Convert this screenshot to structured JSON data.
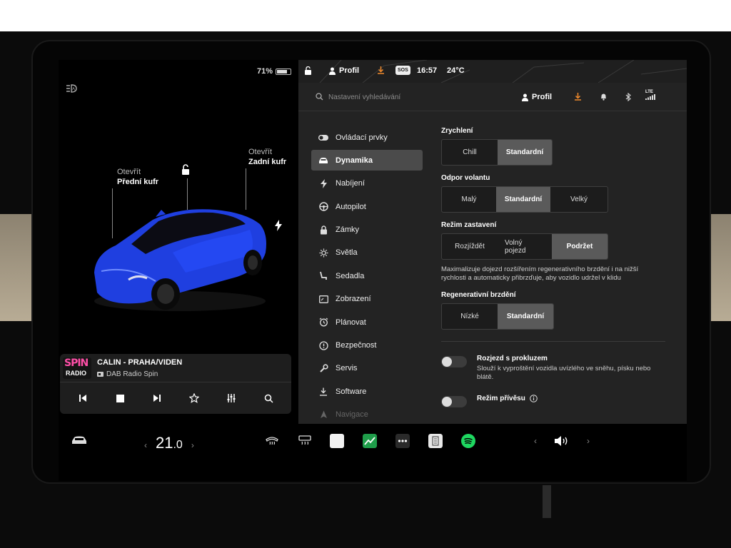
{
  "status": {
    "battery": "71%",
    "profile": "Profil",
    "sos": "SOS",
    "time": "16:57",
    "temperature": "24°C"
  },
  "car": {
    "front_trunk_action": "Otevřít",
    "front_trunk_label": "Přední kufr",
    "rear_trunk_action": "Otevřít",
    "rear_trunk_label": "Zadní kufr",
    "body_color": "#1f3fe0"
  },
  "media": {
    "logo_top": "SPIN",
    "logo_bottom": "RADIO",
    "title": "CALIN - PRAHA/VIDEN",
    "source": "DAB Radio Spin"
  },
  "search": {
    "placeholder": "Nastavení vyhledávání",
    "profile": "Profil",
    "lte": "LTE"
  },
  "menu": [
    {
      "label": "Ovládací prvky",
      "icon": "toggle-icon"
    },
    {
      "label": "Dynamika",
      "icon": "car-icon",
      "active": true
    },
    {
      "label": "Nabíjení",
      "icon": "bolt-icon"
    },
    {
      "label": "Autopilot",
      "icon": "steering-wheel-icon"
    },
    {
      "label": "Zámky",
      "icon": "lock-icon"
    },
    {
      "label": "Světla",
      "icon": "sun-icon"
    },
    {
      "label": "Sedadla",
      "icon": "seat-icon"
    },
    {
      "label": "Zobrazení",
      "icon": "display-icon"
    },
    {
      "label": "Plánovat",
      "icon": "alarm-clock-icon"
    },
    {
      "label": "Bezpečnost",
      "icon": "shield-icon"
    },
    {
      "label": "Servis",
      "icon": "wrench-icon"
    },
    {
      "label": "Software",
      "icon": "download-icon"
    },
    {
      "label": "Navigace",
      "icon": "navigation-icon"
    }
  ],
  "settings": {
    "acceleration": {
      "title": "Zrychlení",
      "options": [
        "Chill",
        "Standardní"
      ],
      "selected": "Standardní"
    },
    "steering": {
      "title": "Odpor volantu",
      "options": [
        "Malý",
        "Standardní",
        "Velký"
      ],
      "selected": "Standardní"
    },
    "stopping": {
      "title": "Režim zastavení",
      "options": [
        "Rozjíždět",
        "Volný pojezd",
        "Podržet"
      ],
      "selected": "Podržet",
      "description": "Maximalizuje dojezd rozšířením regenerativního brzdění i na nižší rychlosti a automaticky přibrzďuje, aby vozidlo udržel v klidu"
    },
    "regen": {
      "title": "Regenerativní brzdění",
      "options": [
        "Nízké",
        "Standardní"
      ],
      "selected": "Standardní"
    },
    "slip_start": {
      "title": "Rozjezd s prokluzem",
      "description": "Slouží k vyproštění vozidla uvízlého ve sněhu, písku nebo blátě.",
      "on": false
    },
    "trailer": {
      "title": "Režim přívěsu",
      "on": false
    }
  },
  "dock": {
    "temperature_main": "21",
    "temperature_decimal": ".0",
    "left_chevron": "‹",
    "right_chevron": "›",
    "vol_left": "‹",
    "vol_right": "›"
  }
}
